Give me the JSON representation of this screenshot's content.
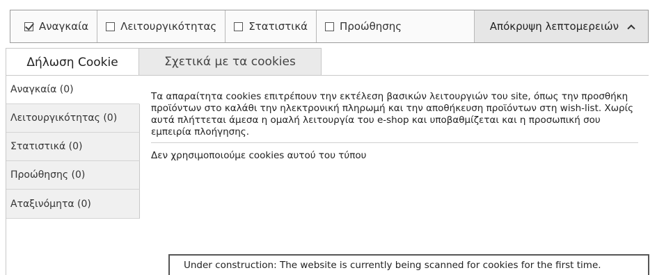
{
  "consent_bar": {
    "checkboxes": [
      {
        "label": "Αναγκαία",
        "checked": true
      },
      {
        "label": "Λειτουργικότητας",
        "checked": false
      },
      {
        "label": "Στατιστικά",
        "checked": false
      },
      {
        "label": "Προώθησης",
        "checked": false
      }
    ],
    "details_toggle_label": "Απόκρυψη λεπτομερειών"
  },
  "tabs": [
    {
      "label": "Δήλωση Cookie",
      "active": true
    },
    {
      "label": "Σχετικά με τα cookies",
      "active": false
    }
  ],
  "categories": [
    {
      "label": "Αναγκαία (0)",
      "active": true
    },
    {
      "label": "Λειτουργικότητας (0)",
      "active": false
    },
    {
      "label": "Στατιστικά (0)",
      "active": false
    },
    {
      "label": "Προώθησης (0)",
      "active": false
    },
    {
      "label": "Αταξινόμητα (0)",
      "active": false
    }
  ],
  "content": {
    "description": "Τα απαραίτητα cookies επιτρέπουν την εκτέλεση βασικών λειτουργιών του site, όπως την προσθήκη προϊόντων στο καλάθι την ηλεκτρονική πληρωμή και την αποθήκευση προϊόντων στη wish-list. Χωρίς αυτά πλήττεται άμεσα η ομαλή λειτουργία του e-shop και υποβαθμίζεται και η προσωπική σου εμπειρία πλοήγησης.",
    "no_cookies_message": "Δεν χρησιμοποιούμε cookies αυτού του τύπου"
  },
  "status_message": "Under construction: The website is currently being scanned for cookies for the first time."
}
